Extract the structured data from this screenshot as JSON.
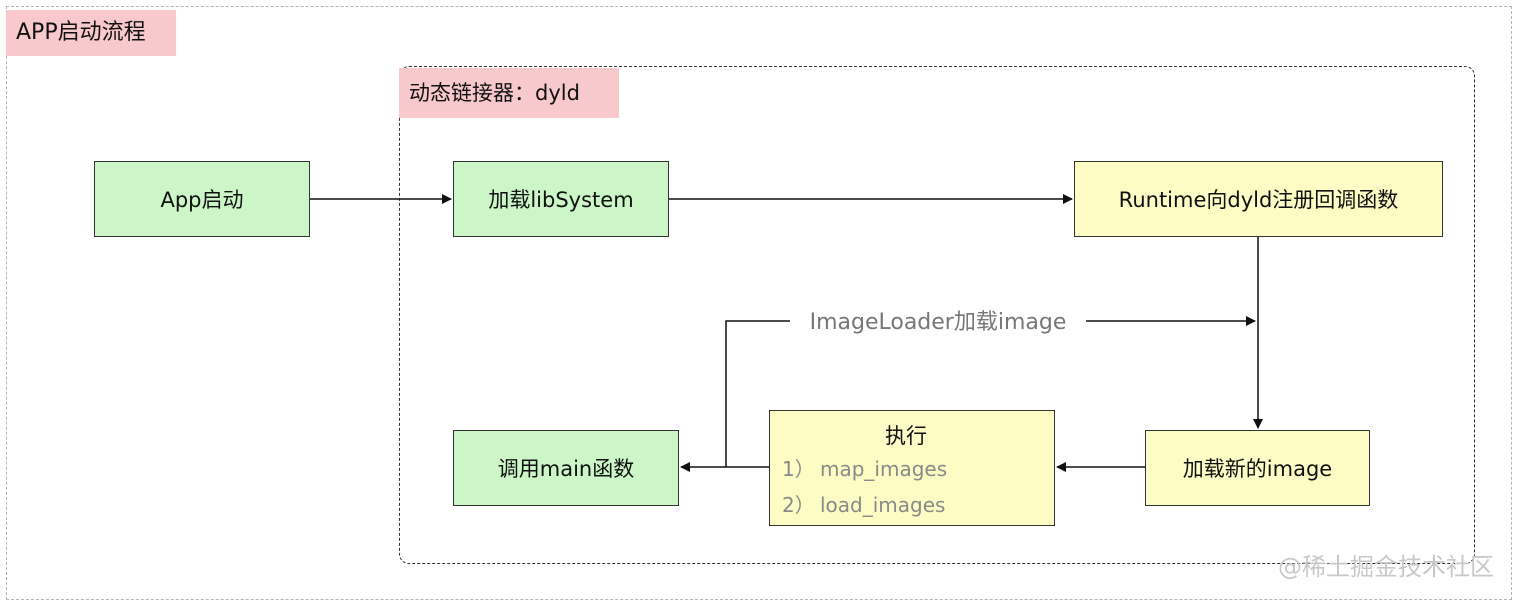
{
  "outer_group": {
    "title": "APP启动流程"
  },
  "inner_group": {
    "title": "动态链接器：dyld"
  },
  "nodes": {
    "app_launch": "App启动",
    "load_libsystem": "加载libSystem",
    "runtime_register": "Runtime向dyld注册回调函数",
    "load_new_image": "加载新的image",
    "execute": {
      "title": "执行",
      "items": [
        {
          "num": "1）",
          "text": "map_images"
        },
        {
          "num": "2）",
          "text": "load_images"
        }
      ]
    },
    "call_main": "调用main函数"
  },
  "edges": {
    "imageloader_label": "ImageLoader加载image"
  },
  "watermark": "@稀土掘金技术社区",
  "colors": {
    "group_label_bg": "#f8c9cc",
    "green_node": "#ccf6c8",
    "yellow_node": "#fcfcc4"
  }
}
